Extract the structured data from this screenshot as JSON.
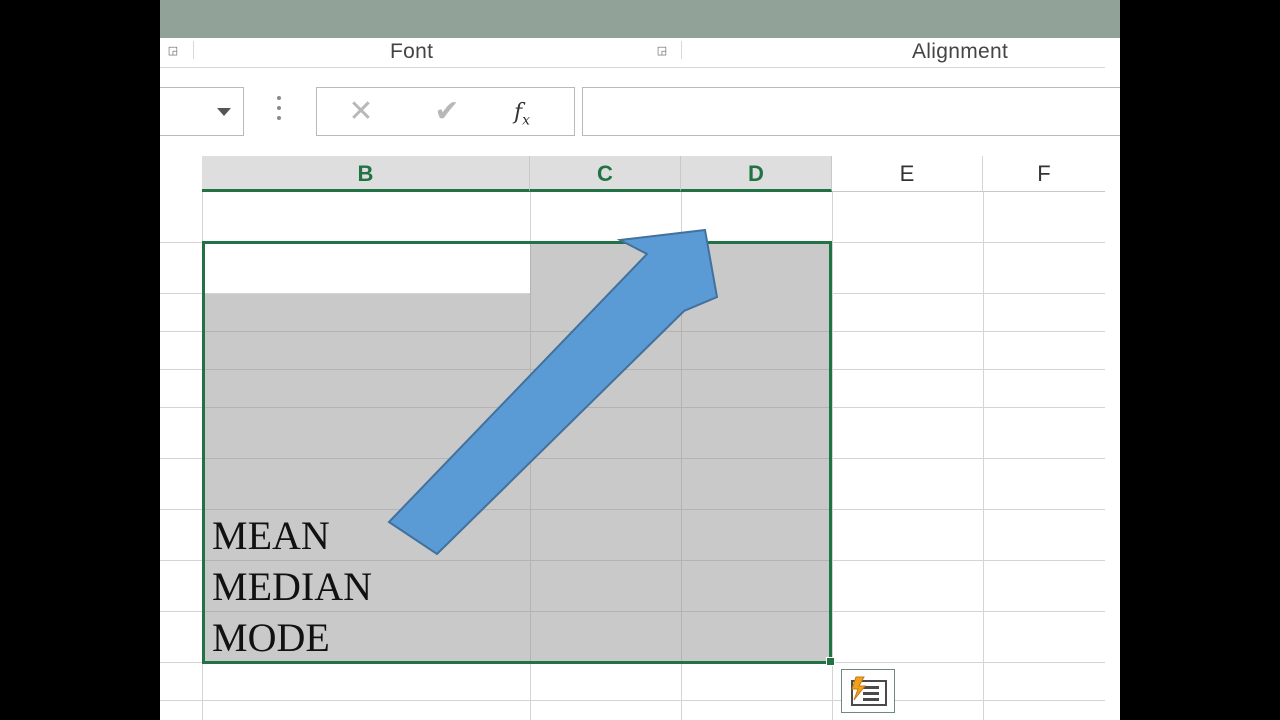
{
  "ribbon": {
    "font_group_label": "Font",
    "alignment_group_label": "Alignment"
  },
  "formula_bar": {
    "cancel_glyph": "✕",
    "enter_glyph": "✔",
    "fx_label": "f",
    "fx_sub": "x",
    "formula_value": ""
  },
  "columns": [
    {
      "letter": "B",
      "selected": true
    },
    {
      "letter": "C",
      "selected": true
    },
    {
      "letter": "D",
      "selected": true
    },
    {
      "letter": "E",
      "selected": false
    },
    {
      "letter": "F",
      "selected": false
    }
  ],
  "cells": {
    "mean": "MEAN",
    "median": "MEDIAN",
    "mode": "MODE"
  },
  "colors": {
    "selection_border": "#217346",
    "selection_fill": "#c9c9c9",
    "arrow_fill": "#5b9bd5",
    "arrow_stroke": "#41719c",
    "ribbon_top": "#91a398"
  },
  "icons": {
    "name_box_dropdown": "chevron-down-icon",
    "quick_analysis": "quick-analysis-icon",
    "annotation_arrow": "arrow-up-right-icon"
  }
}
